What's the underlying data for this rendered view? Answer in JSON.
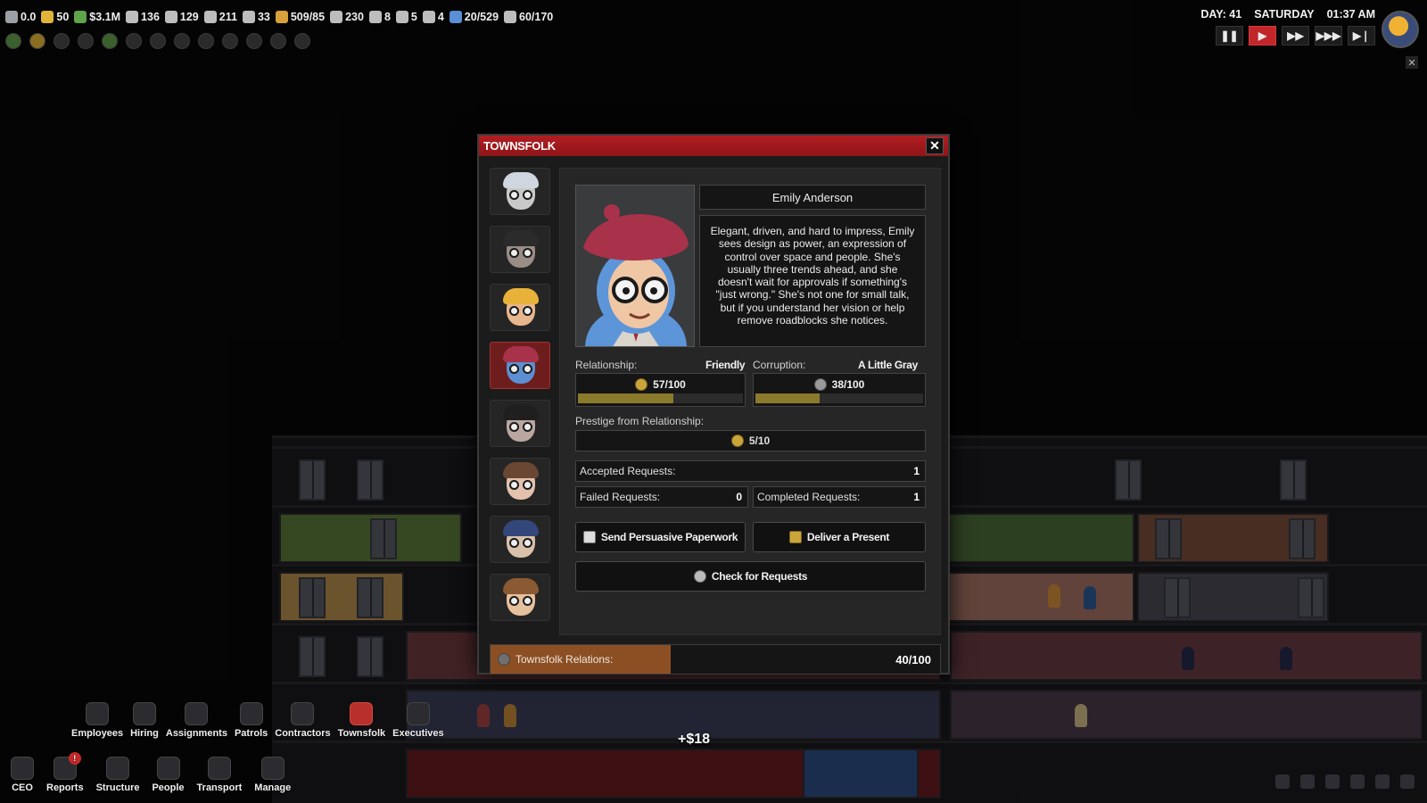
{
  "hud": {
    "stats": [
      {
        "icon": "star-rating-icon",
        "value": "0.0",
        "color": "#9aa0a6"
      },
      {
        "icon": "smiley-icon",
        "value": "50",
        "color": "#e0b43a"
      },
      {
        "icon": "cash-icon",
        "value": "$3.1M",
        "color": "#5fa34a"
      },
      {
        "icon": "building-icon",
        "value": "136",
        "color": "#bdbdbd"
      },
      {
        "icon": "office-icon",
        "value": "129",
        "color": "#bdbdbd"
      },
      {
        "icon": "floors-icon",
        "value": "211",
        "color": "#bdbdbd"
      },
      {
        "icon": "desk-icon",
        "value": "33",
        "color": "#bdbdbd"
      },
      {
        "icon": "capacity-icon",
        "value": "509/85",
        "color": "#d8a03a"
      },
      {
        "icon": "battery-icon",
        "value": "230",
        "color": "#bdbdbd"
      },
      {
        "icon": "worker-icon",
        "value": "8",
        "color": "#bdbdbd"
      },
      {
        "icon": "toilet-icon",
        "value": "5",
        "color": "#bdbdbd"
      },
      {
        "icon": "sofa-icon",
        "value": "4",
        "color": "#bdbdbd"
      },
      {
        "icon": "people-icon",
        "value": "20/529",
        "color": "#5b8fd6"
      },
      {
        "icon": "visitor-icon",
        "value": "60/170",
        "color": "#bdbdbd"
      }
    ],
    "day": "DAY: 41",
    "weekday": "SATURDAY",
    "time": "01:37 AM",
    "speed_buttons": [
      {
        "icon": "pause-icon",
        "glyph": "❚❚",
        "active": false
      },
      {
        "icon": "play-icon",
        "glyph": "▶",
        "active": true
      },
      {
        "icon": "fast-forward-icon",
        "glyph": "▶▶",
        "active": false
      },
      {
        "icon": "faster-forward-icon",
        "glyph": "▶▶▶",
        "active": false
      },
      {
        "icon": "skip-icon",
        "glyph": "▶❘",
        "active": false
      }
    ]
  },
  "modal": {
    "title": "TOWNSFOLK",
    "close_glyph": "✕",
    "portraits": [
      {
        "name": "portrait-1",
        "hair": "#cfd6df",
        "skin": "#c9c9c9",
        "selected": false
      },
      {
        "name": "portrait-2",
        "hair": "#2b2b2b",
        "skin": "#9a8c86",
        "selected": false
      },
      {
        "name": "portrait-3",
        "hair": "#e8b23a",
        "skin": "#e7b68d",
        "selected": false
      },
      {
        "name": "portrait-4",
        "hair": "#a8324a",
        "skin": "#5c8fd1",
        "selected": true
      },
      {
        "name": "portrait-5",
        "hair": "#1f1f1f",
        "skin": "#b9a7a0",
        "selected": false
      },
      {
        "name": "portrait-6",
        "hair": "#6a4733",
        "skin": "#e2c2ad",
        "selected": false
      },
      {
        "name": "portrait-7",
        "hair": "#33477a",
        "skin": "#d9c0aa",
        "selected": false
      },
      {
        "name": "portrait-8",
        "hair": "#8a5a32",
        "skin": "#e6c09d",
        "selected": false
      }
    ],
    "person": {
      "name": "Emily Anderson",
      "description": "Elegant, driven, and hard to impress, Emily sees design as power, an expression of control over space and people. She's usually three trends ahead, and she doesn't wait for approvals if something's \"just wrong.\" She's not one for small talk, but if you understand her vision or help remove roadblocks she notices."
    },
    "relationship": {
      "label": "Relationship:",
      "status": "Friendly",
      "value_text": "57/100",
      "fraction": 0.57
    },
    "corruption": {
      "label": "Corruption:",
      "status": "A Little Gray",
      "value_text": "38/100",
      "fraction": 0.38
    },
    "prestige": {
      "label": "Prestige from Relationship:",
      "value_text": "5/10"
    },
    "accepted": {
      "label": "Accepted Requests:",
      "value": "1"
    },
    "failed": {
      "label": "Failed Requests:",
      "value": "0"
    },
    "completed": {
      "label": "Completed Requests:",
      "value": "1"
    },
    "buttons": {
      "paperwork": "Send Persuasive Paperwork",
      "present": "Deliver a Present",
      "check": "Check for Requests"
    },
    "relations": {
      "label": "Townsfolk Relations:",
      "value_text": "40/100",
      "fraction": 0.4
    }
  },
  "nav_top": [
    {
      "name": "nav-employees",
      "label": "Employees",
      "active": false
    },
    {
      "name": "nav-hiring",
      "label": "Hiring",
      "active": false
    },
    {
      "name": "nav-assignments",
      "label": "Assignments",
      "active": false
    },
    {
      "name": "nav-patrols",
      "label": "Patrols",
      "active": false
    },
    {
      "name": "nav-contractors",
      "label": "Contractors",
      "active": false
    },
    {
      "name": "nav-townsfolk",
      "label": "Townsfolk",
      "active": true
    },
    {
      "name": "nav-executives",
      "label": "Executives",
      "active": false
    }
  ],
  "nav_bottom": [
    {
      "name": "nav-ceo",
      "label": "CEO",
      "badge": ""
    },
    {
      "name": "nav-reports",
      "label": "Reports",
      "badge": "!"
    },
    {
      "name": "nav-structure",
      "label": "Structure",
      "badge": ""
    },
    {
      "name": "nav-people",
      "label": "People",
      "badge": ""
    },
    {
      "name": "nav-transport",
      "label": "Transport",
      "badge": ""
    },
    {
      "name": "nav-manage",
      "label": "Manage",
      "badge": ""
    }
  ],
  "money_popup": "+$18",
  "colors": {
    "accent": "#b21e22",
    "bar_gold": "#8a7a2b",
    "relations_fill": "#8c4f24"
  }
}
